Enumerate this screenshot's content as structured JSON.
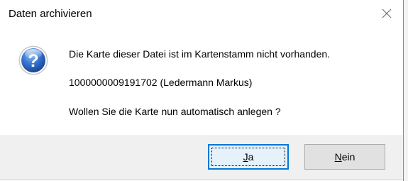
{
  "window": {
    "title": "Daten archivieren",
    "close_icon": "close-icon"
  },
  "message": {
    "icon": "question-icon",
    "line1": "Die Karte dieser Datei ist im Kartenstamm nicht vorhanden.",
    "line2": "1000000009191702 (Ledermann Markus)",
    "line3": "Wollen Sie die Karte nun automatisch anlegen ?"
  },
  "buttons": {
    "yes": {
      "mnemonic": "J",
      "rest": "a",
      "label": "Ja"
    },
    "no": {
      "mnemonic": "N",
      "rest": "ein",
      "label": "Nein"
    }
  },
  "colors": {
    "accent": "#0078d7",
    "icon_blue": "#1f5fbf",
    "footer_bg": "#f0f0f0"
  }
}
